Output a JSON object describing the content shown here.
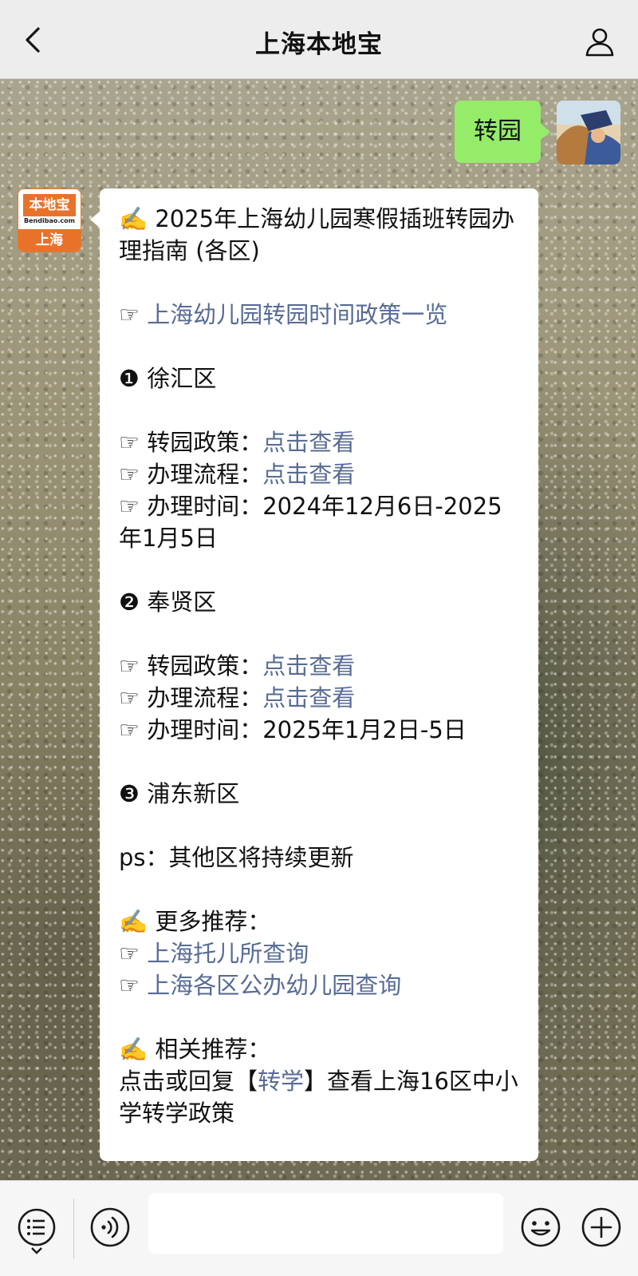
{
  "navbar": {
    "title": "上海本地宝"
  },
  "outgoing": {
    "text": "转园"
  },
  "bot": {
    "logo_name": "本地宝",
    "logo_url": "Bendibao.com",
    "logo_city": "上海"
  },
  "message": {
    "title_prefix": "✍️ ",
    "title": "2025年上海幼儿园寒假插班转园办理指南 (各区)",
    "policy_link_prefix": "☞ ",
    "policy_link": "上海幼儿园转园时间政策一览",
    "districts": [
      {
        "heading": "❶ 徐汇区",
        "policy_label": "☞ 转园政策：",
        "policy_link": "点击查看",
        "process_label": "☞ 办理流程：",
        "process_link": "点击查看",
        "time_label": "☞ 办理时间：",
        "time_value": "2024年12月6日-2025年1月5日"
      },
      {
        "heading": "❷ 奉贤区",
        "policy_label": "☞ 转园政策：",
        "policy_link": "点击查看",
        "process_label": "☞ 办理流程：",
        "process_link": "点击查看",
        "time_label": "☞ 办理时间：",
        "time_value": "2025年1月2日-5日"
      },
      {
        "heading": "❸ 浦东新区"
      }
    ],
    "ps": "ps：其他区将持续更新",
    "more_heading": "✍️ 更多推荐：",
    "more_links": [
      {
        "prefix": "☞ ",
        "label": "上海托儿所查询"
      },
      {
        "prefix": "☞ ",
        "label": "上海各区公办幼儿园查询"
      }
    ],
    "related_heading": "✍️ 相关推荐：",
    "related_before": "点击或回复【",
    "related_keyword": "转学",
    "related_after": "】查看上海16区中小学转学政策"
  },
  "icons": {
    "back": "chevron-left-icon",
    "profile": "person-icon",
    "menu": "menu-list-icon",
    "voice": "voice-icon",
    "emoji": "emoji-icon",
    "add": "plus-icon"
  },
  "colors": {
    "link": "#576b95",
    "outgoing_bubble": "#95ec69",
    "brand": "#e8722a"
  }
}
